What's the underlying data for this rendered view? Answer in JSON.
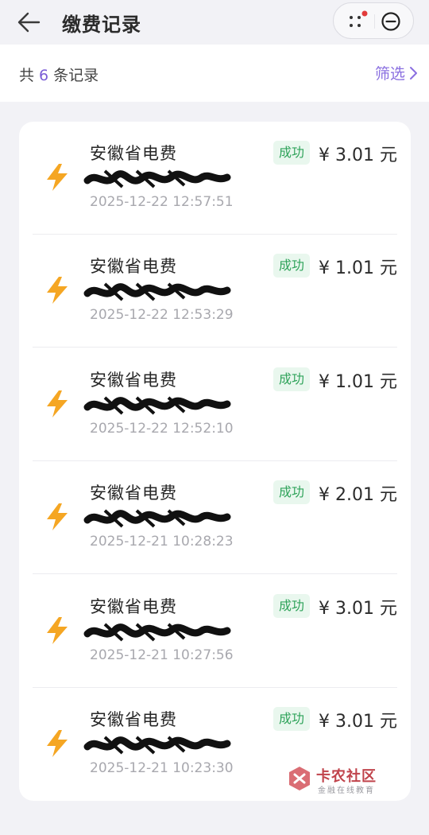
{
  "header": {
    "title": "缴费记录",
    "back_icon": "arrow-left-icon",
    "more_icon": "more-dots-icon",
    "close_icon": "minus-circle-icon"
  },
  "summary": {
    "prefix": "共",
    "count": "6",
    "suffix": "条记录",
    "filter_label": "筛选",
    "filter_icon": "chevron-right-icon",
    "accent_color": "#8a6fe0"
  },
  "records": [
    {
      "name": "安徽省电费",
      "status": "成功",
      "amount": "¥ 3.01 元",
      "time": "2025-12-22 12:57:51"
    },
    {
      "name": "安徽省电费",
      "status": "成功",
      "amount": "¥ 1.01 元",
      "time": "2025-12-22 12:53:29"
    },
    {
      "name": "安徽省电费",
      "status": "成功",
      "amount": "¥ 1.01 元",
      "time": "2025-12-22 12:52:10"
    },
    {
      "name": "安徽省电费",
      "status": "成功",
      "amount": "¥ 2.01 元",
      "time": "2025-12-21 10:28:23"
    },
    {
      "name": "安徽省电费",
      "status": "成功",
      "amount": "¥ 3.01 元",
      "time": "2025-12-21 10:27:56"
    },
    {
      "name": "安徽省电费",
      "status": "成功",
      "amount": "¥ 3.01 元",
      "time": "2025-12-21 10:23:30"
    }
  ],
  "watermark": {
    "main": "卡农社区",
    "sub": "金融在线教育"
  },
  "colors": {
    "success_bg": "#e9f7ee",
    "success_text": "#2fa35a",
    "bolt": "#f5a623"
  }
}
